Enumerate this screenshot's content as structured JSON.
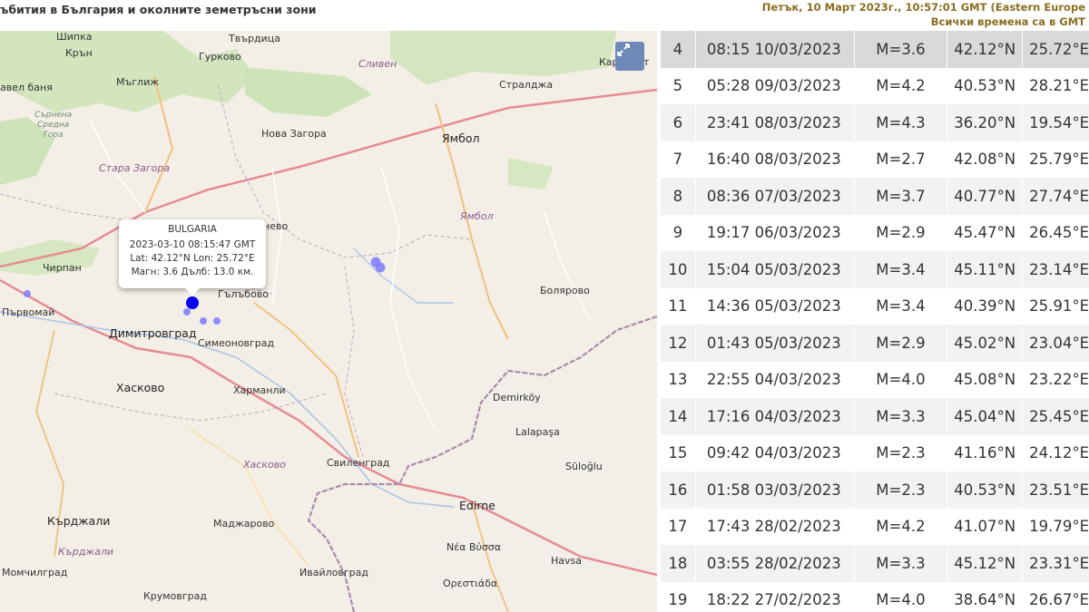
{
  "header": {
    "title": "ъбития в България и околните земетръсни зони",
    "datetime": "Петък, 10 Март 2023г., 10:57:01 GMT (Eastern Europe",
    "timezone_note": "Всички времена са в GMT"
  },
  "map": {
    "labels": {
      "shipka": "Шипка",
      "tvarditsa": "Твърдица",
      "kran": "Крън",
      "gurkovo": "Гурково",
      "karnobat": "Карнобат",
      "myglizh": "Мъглиж",
      "sliven": "Сливен",
      "pavel_banya": "авел баня",
      "straldzha": "Стралджа",
      "sarnena": "Сърнена\nСредна\nГора",
      "nova_zagora": "Нова Загора",
      "yambol": "Ямбол",
      "stara_zagora": "Стара Загора",
      "yambol_region": "Ямбол",
      "radnevo": "нево",
      "chirpan": "Чирпан",
      "galabovo": "Гълъбово",
      "parvomay": "Първомай",
      "bolyarovo": "Болярово",
      "dimitrovgrad": "Димитровград",
      "simeonovgrad": "Симеоновград",
      "haskovo": "Хасково",
      "harmanli": "Харманли",
      "demirkoy": "Demirköy",
      "lalapasa": "Lalapaşa",
      "svilengrad": "Свиленград",
      "haskovo_region": "Хасково",
      "suloglu": "Süloğlu",
      "edirne": "Edirne",
      "kardzhali": "Кърджали",
      "madzharovo": "Маджарово",
      "kardzhali_region": "Кърджали",
      "momchilgrad": "Момчилград",
      "nea_vyssa": "Νέα Βύσσα",
      "havsa": "Havsa",
      "ivaylovgrad": "Ивайловград",
      "krumovgrad": "Крумовград",
      "orestiada": "Ορεστιάδα",
      "bulgaria_mark": "BULGARIA"
    },
    "fullscreen_icon": "expand-arrows-icon",
    "popup": {
      "title": "BULGARIA",
      "line1": "2023-03-10 08:15:47 GMT",
      "line2": "Lat: 42.12°N Lon: 25.72°E",
      "line3": "Магн: 3.6 Дълб: 13.0 км."
    }
  },
  "quakes": [
    {
      "n": "4",
      "time": "08:15 10/03/2023",
      "mag": "M=3.6",
      "lat": "42.12°N",
      "lon": "25.72°E"
    },
    {
      "n": "5",
      "time": "05:28 09/03/2023",
      "mag": "M=4.2",
      "lat": "40.53°N",
      "lon": "28.21°E"
    },
    {
      "n": "6",
      "time": "23:41 08/03/2023",
      "mag": "M=4.3",
      "lat": "36.20°N",
      "lon": "19.54°E"
    },
    {
      "n": "7",
      "time": "16:40 08/03/2023",
      "mag": "M=2.7",
      "lat": "42.08°N",
      "lon": "25.79°E"
    },
    {
      "n": "8",
      "time": "08:36 07/03/2023",
      "mag": "M=3.7",
      "lat": "40.77°N",
      "lon": "27.74°E"
    },
    {
      "n": "9",
      "time": "19:17 06/03/2023",
      "mag": "M=2.9",
      "lat": "45.47°N",
      "lon": "26.45°E"
    },
    {
      "n": "10",
      "time": "15:04 05/03/2023",
      "mag": "M=3.4",
      "lat": "45.11°N",
      "lon": "23.14°E"
    },
    {
      "n": "11",
      "time": "14:36 05/03/2023",
      "mag": "M=3.4",
      "lat": "40.39°N",
      "lon": "25.91°E"
    },
    {
      "n": "12",
      "time": "01:43 05/03/2023",
      "mag": "M=2.9",
      "lat": "45.02°N",
      "lon": "23.04°E"
    },
    {
      "n": "13",
      "time": "22:55 04/03/2023",
      "mag": "M=4.0",
      "lat": "45.08°N",
      "lon": "23.22°E"
    },
    {
      "n": "14",
      "time": "17:16 04/03/2023",
      "mag": "M=3.3",
      "lat": "45.04°N",
      "lon": "25.45°E"
    },
    {
      "n": "15",
      "time": "09:42 04/03/2023",
      "mag": "M=2.3",
      "lat": "41.16°N",
      "lon": "24.12°E"
    },
    {
      "n": "16",
      "time": "01:58 03/03/2023",
      "mag": "M=2.3",
      "lat": "40.53°N",
      "lon": "23.51°E"
    },
    {
      "n": "17",
      "time": "17:43 28/02/2023",
      "mag": "M=4.2",
      "lat": "41.07°N",
      "lon": "19.79°E"
    },
    {
      "n": "18",
      "time": "03:55 28/02/2023",
      "mag": "M=3.3",
      "lat": "45.12°N",
      "lon": "23.31°E"
    },
    {
      "n": "19",
      "time": "18:22 27/02/2023",
      "mag": "M=4.0",
      "lat": "38.64°N",
      "lon": "26.67°E"
    }
  ],
  "colors": {
    "marker_selected": "#0000ee",
    "marker_other": "#7b7bff",
    "header_accent": "#8a6d1f",
    "selected_row": "#d9d9d9"
  }
}
